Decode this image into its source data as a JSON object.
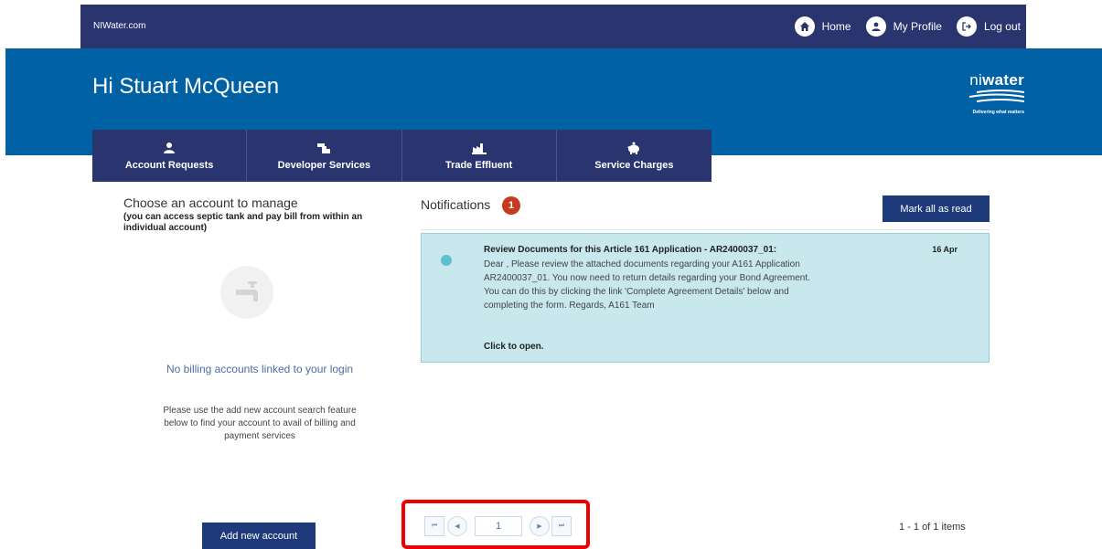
{
  "topbar": {
    "site_label": "NIWater.com",
    "nav": [
      {
        "label": "Home",
        "icon": "home-icon"
      },
      {
        "label": "My Profile",
        "icon": "user-icon"
      },
      {
        "label": "Log out",
        "icon": "logout-icon"
      }
    ]
  },
  "header": {
    "greeting": "Hi Stuart McQueen",
    "logo_text_ni": "ni",
    "logo_text_water": "water",
    "logo_tagline": "Delivering what matters"
  },
  "services": [
    {
      "label": "Account Requests",
      "icon": "user-icon"
    },
    {
      "label": "Developer Services",
      "icon": "pipe-icon"
    },
    {
      "label": "Trade Effluent",
      "icon": "factory-icon"
    },
    {
      "label": "Service Charges",
      "icon": "piggy-bank-icon"
    }
  ],
  "accounts": {
    "title": "Choose an account to manage",
    "subtitle": "(you can access septic tank and pay bill from within an individual account)",
    "empty_icon": "tap-icon",
    "empty_title": "No billing accounts linked to your login",
    "empty_hint": "Please use the add new account search feature below to find your account to avail of billing and payment services",
    "add_button": "Add new account"
  },
  "notifications": {
    "title": "Notifications",
    "count": "1",
    "mark_all": "Mark all as read",
    "items": [
      {
        "heading": "Review Documents for this Article 161 Application - AR2400037_01:",
        "body": "Dear , Please review the attached documents regarding your A161 Application AR2400037_01. You now need to return details regarding your Bond Agreement. You can do this by clicking the link 'Complete Agreement Details' below and completing the form. Regards, A161 Team",
        "cta": "Click to open.",
        "date": "16 Apr"
      }
    ],
    "pager": {
      "page": "1",
      "summary": "1 - 1 of 1 items",
      "first_glyph": "⏮",
      "prev_glyph": "◀",
      "next_glyph": "▶",
      "last_glyph": "⏭"
    }
  },
  "colors": {
    "topbar": "#2a3570",
    "hero": "#0062a5",
    "button": "#1f3a7a",
    "badge": "#c63b20",
    "card": "#c8e8ee",
    "highlight": "#e00000"
  }
}
